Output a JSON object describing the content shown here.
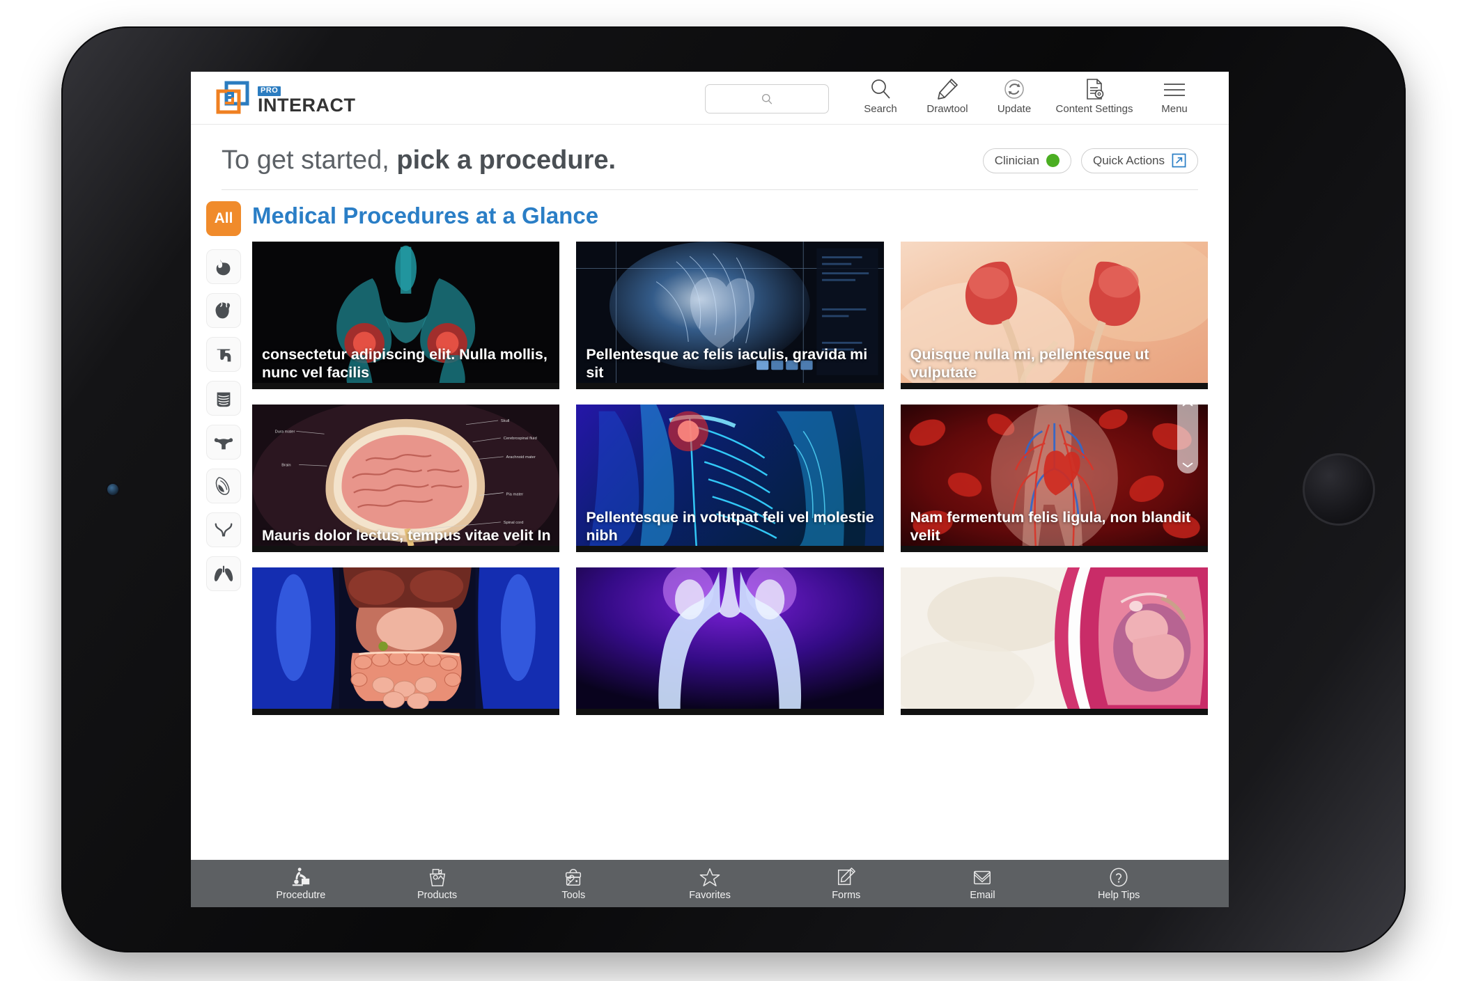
{
  "app": {
    "brand_pro": "PRO",
    "brand_name": "INTERACT"
  },
  "search": {
    "value": "",
    "placeholder": ""
  },
  "toolbar": [
    {
      "label": "Search",
      "icon": "search-icon"
    },
    {
      "label": "Drawtool",
      "icon": "pencil-icon"
    },
    {
      "label": "Update",
      "icon": "refresh-icon"
    },
    {
      "label": "Content Settings",
      "icon": "document-settings-icon"
    },
    {
      "label": "Menu",
      "icon": "hamburger-menu-icon"
    }
  ],
  "header": {
    "title_light": "To get started,",
    "title_bold": "pick a procedure.",
    "role_pill": "Clinician",
    "role_status_color": "#4bae22",
    "quick_actions": "Quick Actions"
  },
  "sidebar": {
    "all_label": "All",
    "items": [
      {
        "icon": "stomach-icon",
        "label": "Stomach"
      },
      {
        "icon": "heart-icon",
        "label": "Heart"
      },
      {
        "icon": "colon-icon",
        "label": "Colon"
      },
      {
        "icon": "small-intestine-icon",
        "label": "Small Intestine"
      },
      {
        "icon": "uterus-icon",
        "label": "Uterus"
      },
      {
        "icon": "prostate-icon",
        "label": "Prostate"
      },
      {
        "icon": "clavicle-icon",
        "label": "Clavicle"
      },
      {
        "icon": "lungs-icon",
        "label": "Lungs"
      }
    ]
  },
  "main": {
    "section_title": "Medical Procedures at a Glance",
    "cards": [
      {
        "caption": "consectetur adipiscing elit. Nulla mollis, nunc vel facilis",
        "art": "pelvis-xray"
      },
      {
        "caption": "Pellentesque ac felis iaculis, gravida mi sit",
        "art": "heart-scan"
      },
      {
        "caption": "Quisque nulla mi, pellentesque ut vulputate",
        "art": "kidneys"
      },
      {
        "caption": "Mauris dolor lectus, tempus vitae velit In",
        "art": "brain-anatomy"
      },
      {
        "caption": "Pellentesque in volutpat feli vel molestie nibh",
        "art": "shoulder-xray"
      },
      {
        "caption": "Nam fermentum felis ligula, non blandit velit",
        "art": "circulatory"
      },
      {
        "caption": "",
        "art": "abdomen-organs"
      },
      {
        "caption": "",
        "art": "hip-bones"
      },
      {
        "caption": "",
        "art": "fetus-womb"
      }
    ]
  },
  "bottom_nav": [
    {
      "label": "Procedutre",
      "icon": "procedure-icon"
    },
    {
      "label": "Products",
      "icon": "products-box-icon"
    },
    {
      "label": "Tools",
      "icon": "toolbox-icon"
    },
    {
      "label": "Favorites",
      "icon": "star-icon"
    },
    {
      "label": "Forms",
      "icon": "form-pencil-icon"
    },
    {
      "label": "Email",
      "icon": "envelope-icon"
    },
    {
      "label": "Help Tips",
      "icon": "question-circle-icon"
    }
  ],
  "colors": {
    "accent_orange": "#f08b2b",
    "accent_blue": "#2a7ec6",
    "nav_bar": "#5d6063",
    "status_green": "#4bae22"
  }
}
